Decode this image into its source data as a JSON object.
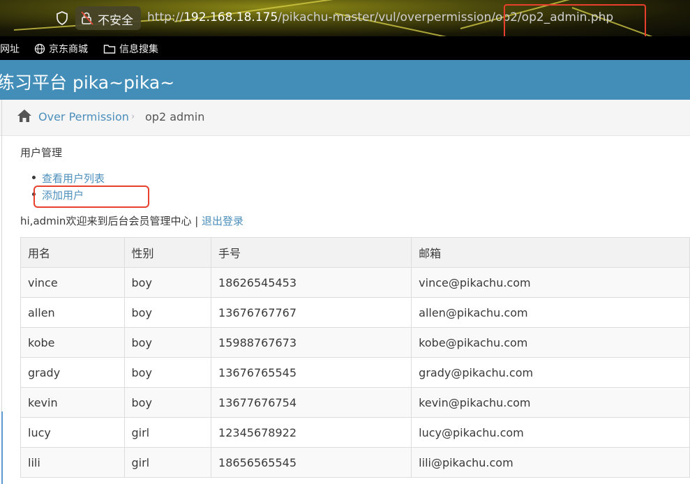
{
  "browser": {
    "security_label": "不安全",
    "url_prefix": "http://",
    "url_host": "192.168.18.175",
    "url_path": "/pikachu-master/vul/overpermission/op2/op2_admin.php",
    "bookmarks": [
      {
        "label": "网址",
        "icon": "link-icon"
      },
      {
        "label": "京东商城",
        "icon": "globe-icon"
      },
      {
        "label": "信息搜集",
        "icon": "folder-icon"
      }
    ],
    "annotation_color": "#e8402c"
  },
  "header": {
    "title": "练习平台 pika~pika~",
    "color": "#438eb9"
  },
  "breadcrumb": {
    "parent": "Over Permission",
    "current": "op2 admin",
    "separator": "›"
  },
  "content": {
    "section_title": "用户管理",
    "menu": [
      "查看用户列表",
      "添加用户"
    ],
    "welcome_text": "hi,admin欢迎来到后台会员管理中心 | ",
    "logout_label": "退出登录"
  },
  "table": {
    "headers": [
      "用名",
      "性别",
      "手号",
      "邮箱"
    ],
    "rows": [
      [
        "vince",
        "boy",
        "18626545453",
        "vince@pikachu.com"
      ],
      [
        "allen",
        "boy",
        "13676767767",
        "allen@pikachu.com"
      ],
      [
        "kobe",
        "boy",
        "15988767673",
        "kobe@pikachu.com"
      ],
      [
        "grady",
        "boy",
        "13676765545",
        "grady@pikachu.com"
      ],
      [
        "kevin",
        "boy",
        "13677676754",
        "kevin@pikachu.com"
      ],
      [
        "lucy",
        "girl",
        "12345678922",
        "lucy@pikachu.com"
      ],
      [
        "lili",
        "girl",
        "18656565545",
        "lili@pikachu.com"
      ]
    ]
  }
}
